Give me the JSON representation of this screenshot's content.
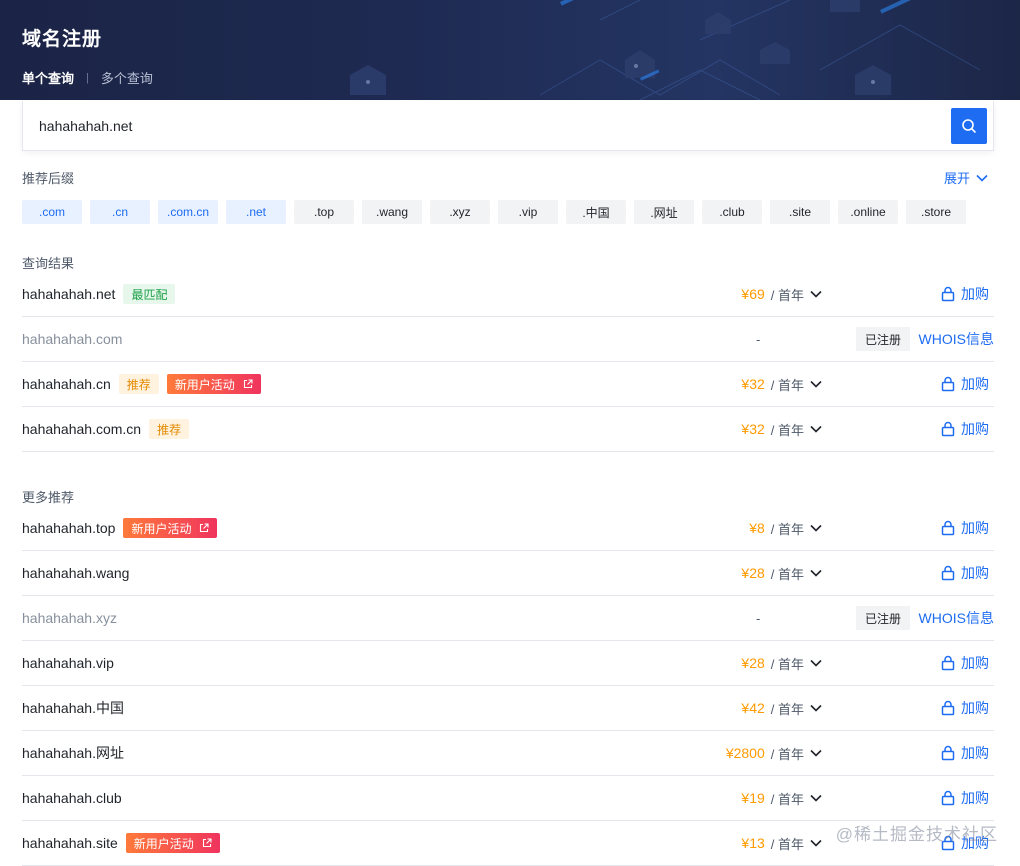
{
  "header": {
    "title": "域名注册",
    "tabs": [
      {
        "label": "单个查询",
        "active": true
      },
      {
        "label": "多个查询",
        "active": false
      }
    ]
  },
  "search": {
    "value": "hahahahah.net",
    "button_icon": "search-icon"
  },
  "suffix_section": {
    "label": "推荐后缀",
    "expand_label": "展开",
    "suffixes": [
      {
        "label": ".com",
        "selected": true
      },
      {
        "label": ".cn",
        "selected": true
      },
      {
        "label": ".com.cn",
        "selected": true
      },
      {
        "label": ".net",
        "selected": true
      },
      {
        "label": ".top",
        "selected": false
      },
      {
        "label": ".wang",
        "selected": false
      },
      {
        "label": ".xyz",
        "selected": false
      },
      {
        "label": ".vip",
        "selected": false
      },
      {
        "label": ".中国",
        "selected": false
      },
      {
        "label": ".网址",
        "selected": false
      },
      {
        "label": ".club",
        "selected": false
      },
      {
        "label": ".site",
        "selected": false
      },
      {
        "label": ".online",
        "selected": false
      },
      {
        "label": ".store",
        "selected": false
      }
    ]
  },
  "results": {
    "label": "查询结果",
    "rows": [
      {
        "domain": "hahahahah.net",
        "tags": [
          {
            "type": "match",
            "label": "最匹配"
          }
        ],
        "price": "¥69",
        "per": "/ 首年",
        "action": "加购"
      },
      {
        "domain": "hahahahah.com",
        "taken": true,
        "dash": "-",
        "registered_label": "已注册",
        "whois_label": "WHOIS信息"
      },
      {
        "domain": "hahahahah.cn",
        "tags": [
          {
            "type": "rec",
            "label": "推荐"
          },
          {
            "type": "promo",
            "label": "新用户活动"
          }
        ],
        "price": "¥32",
        "per": "/ 首年",
        "action": "加购"
      },
      {
        "domain": "hahahahah.com.cn",
        "tags": [
          {
            "type": "rec",
            "label": "推荐"
          }
        ],
        "price": "¥32",
        "per": "/ 首年",
        "action": "加购"
      }
    ]
  },
  "more": {
    "label": "更多推荐",
    "rows": [
      {
        "domain": "hahahahah.top",
        "tags": [
          {
            "type": "promo",
            "label": "新用户活动"
          }
        ],
        "price": "¥8",
        "per": "/ 首年",
        "action": "加购"
      },
      {
        "domain": "hahahahah.wang",
        "tags": [],
        "price": "¥28",
        "per": "/ 首年",
        "action": "加购"
      },
      {
        "domain": "hahahahah.xyz",
        "taken": true,
        "dash": "-",
        "registered_label": "已注册",
        "whois_label": "WHOIS信息"
      },
      {
        "domain": "hahahahah.vip",
        "tags": [],
        "price": "¥28",
        "per": "/ 首年",
        "action": "加购"
      },
      {
        "domain": "hahahahah.中国",
        "tags": [],
        "price": "¥42",
        "per": "/ 首年",
        "action": "加购"
      },
      {
        "domain": "hahahahah.网址",
        "tags": [],
        "price": "¥2800",
        "per": "/ 首年",
        "action": "加购"
      },
      {
        "domain": "hahahahah.club",
        "tags": [],
        "price": "¥19",
        "per": "/ 首年",
        "action": "加购"
      },
      {
        "domain": "hahahahah.site",
        "tags": [
          {
            "type": "promo",
            "label": "新用户活动"
          }
        ],
        "price": "¥13",
        "per": "/ 首年",
        "action": "加购"
      }
    ]
  },
  "watermark": "@稀土掘金技术社区",
  "colors": {
    "accent": "#1e6cf2",
    "price": "#ff9a00",
    "banner": "#1e2a52"
  }
}
